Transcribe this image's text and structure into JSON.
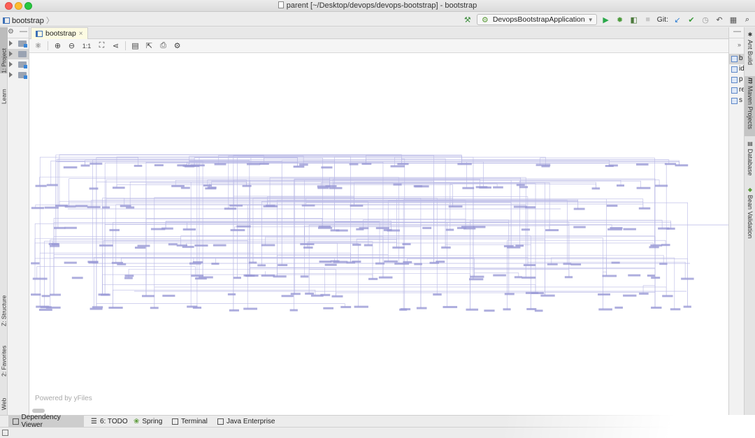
{
  "window": {
    "title": "parent [~/Desktop/devops/devops-bootstrap] - bootstrap"
  },
  "navbar": {
    "breadcrumb": "bootstrap",
    "run_config": "DevopsBootstrapApplication",
    "git_label": "Git:"
  },
  "left_strip": {
    "tabs": [
      "1: Project",
      "Learn",
      "Z: Structure",
      "2: Favorites",
      "Web"
    ]
  },
  "editor": {
    "tab_label": "bootstrap",
    "tab_close": "×",
    "zoom_label": "1:1",
    "powered_by": "Powered by yFiles"
  },
  "right_panel": {
    "items": [
      "b",
      "id",
      "p",
      "re",
      "s"
    ]
  },
  "right_strip": {
    "tabs": [
      "Ant Build",
      "Maven Projects",
      "Database",
      "Bean Validation"
    ]
  },
  "bottom_bar": {
    "tabs": [
      "Dependency Viewer",
      "6: TODO",
      "Spring",
      "Terminal",
      "Java Enterprise"
    ]
  },
  "colors": {
    "graph_line": "#b9b9e6",
    "graph_node": "#9a9ad6",
    "tab_active": "#fdfbe2",
    "run_green": "#2aa84a",
    "git_blue": "#2f7fd3"
  }
}
